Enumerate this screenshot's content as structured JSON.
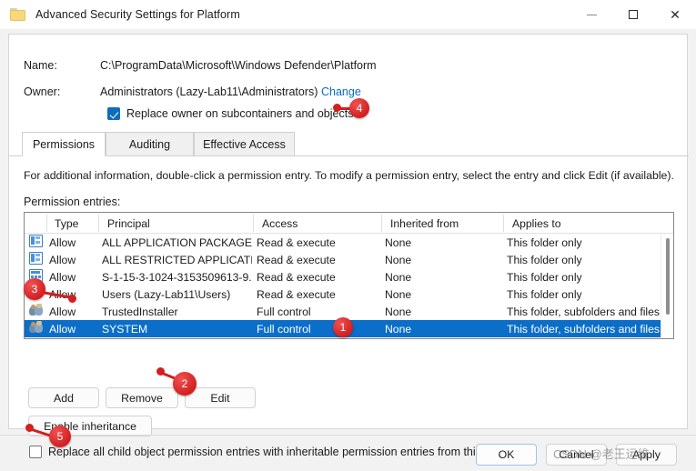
{
  "window": {
    "title": "Advanced Security Settings for Platform",
    "icon": "folder-icon",
    "minimize_label": "—",
    "maximize_label": "□",
    "close_label": "✕"
  },
  "header": {
    "name_label": "Name:",
    "name_value": "C:\\ProgramData\\Microsoft\\Windows Defender\\Platform",
    "owner_label": "Owner:",
    "owner_value": "Administrators (Lazy-Lab11\\Administrators)",
    "change_link": "Change",
    "replace_owner_checkbox": {
      "label": "Replace owner on subcontainers and objects",
      "checked": true
    }
  },
  "tabs": [
    {
      "label": "Permissions",
      "active": true
    },
    {
      "label": "Auditing",
      "active": false
    },
    {
      "label": "Effective Access",
      "active": false
    }
  ],
  "main": {
    "info_text": "For additional information, double-click a permission entry. To modify a permission entry, select the entry and click Edit (if available).",
    "entries_label": "Permission entries:"
  },
  "table": {
    "columns": [
      "Type",
      "Principal",
      "Access",
      "Inherited from",
      "Applies to"
    ],
    "rows": [
      {
        "icon": "app-package-icon",
        "type": "Allow",
        "principal": "ALL APPLICATION PACKAGES",
        "access": "Read & execute",
        "inherited_from": "None",
        "applies_to": "This folder only",
        "selected": false
      },
      {
        "icon": "app-package-icon",
        "type": "Allow",
        "principal": "ALL RESTRICTED APPLICATIO...",
        "access": "Read & execute",
        "inherited_from": "None",
        "applies_to": "This folder only",
        "selected": false
      },
      {
        "icon": "sid-icon",
        "type": "Allow",
        "principal": "S-1-15-3-1024-3153509613-9...",
        "access": "Read & execute",
        "inherited_from": "None",
        "applies_to": "This folder only",
        "selected": false
      },
      {
        "icon": "users-group-icon",
        "type": "Allow",
        "principal": "Users (Lazy-Lab11\\Users)",
        "access": "Read & execute",
        "inherited_from": "None",
        "applies_to": "This folder only",
        "selected": false
      },
      {
        "icon": "users-group-icon",
        "type": "Allow",
        "principal": "TrustedInstaller",
        "access": "Full control",
        "inherited_from": "None",
        "applies_to": "This folder, subfolders and files",
        "selected": false
      },
      {
        "icon": "users-group-icon",
        "type": "Allow",
        "principal": "SYSTEM",
        "access": "Full control",
        "inherited_from": "None",
        "applies_to": "This folder, subfolders and files",
        "selected": true
      }
    ]
  },
  "buttons": {
    "add": "Add",
    "remove": "Remove",
    "edit": "Edit",
    "enable_inheritance": "Enable inheritance"
  },
  "replace_child_checkbox": {
    "label": "Replace all child object permission entries with inheritable permission entries from this object",
    "checked": false
  },
  "footer": {
    "ok": "OK",
    "cancel": "Cancel",
    "apply": "Apply"
  },
  "watermark": "CSDN @老王运维",
  "markers": {
    "m1": "1",
    "m2": "2",
    "m3": "3",
    "m4": "4",
    "m5": "5"
  },
  "colors": {
    "accent_blue": "#0b6ec8",
    "link_blue": "#0a68c8",
    "marker_red": "#d31f1f",
    "checkbox_blue": "#0f6cbd"
  }
}
